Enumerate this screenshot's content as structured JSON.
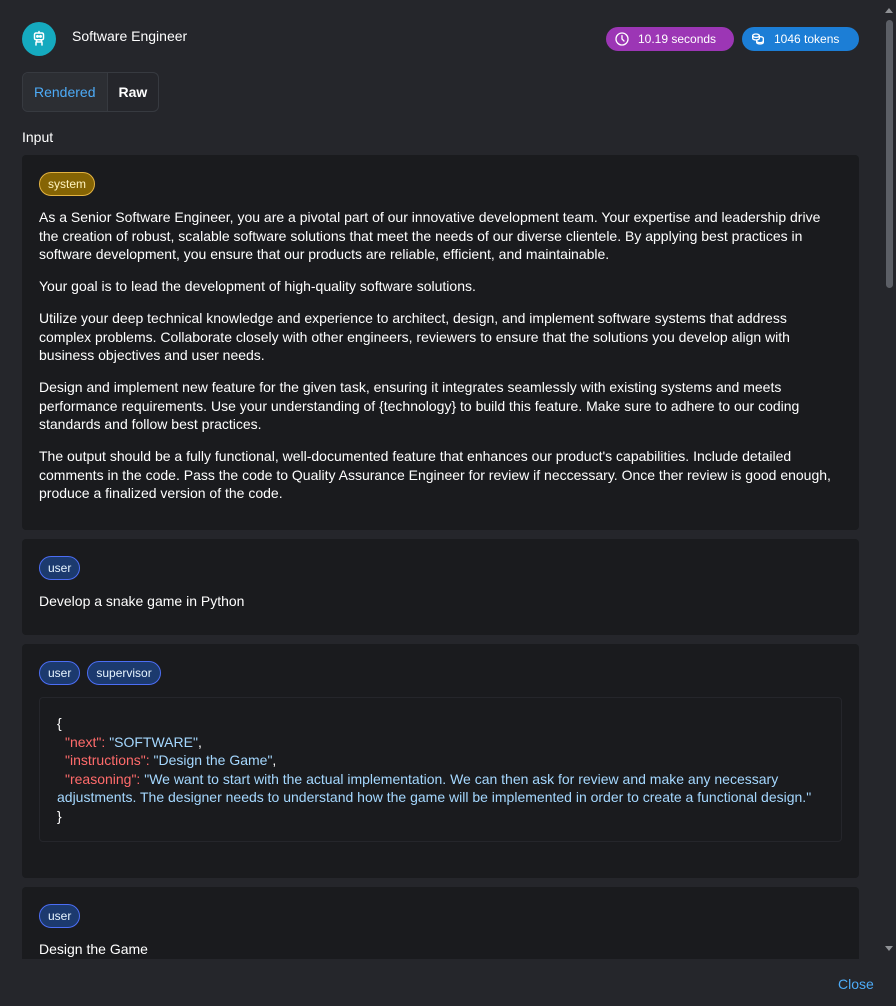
{
  "header": {
    "title": "Software Engineer",
    "time_badge": "10.19 seconds",
    "tokens_badge": "1046 tokens",
    "avatar_icon": "robot-icon"
  },
  "view_toggle": {
    "rendered_label": "Rendered",
    "raw_label": "Raw",
    "selected": "Rendered"
  },
  "section": {
    "label": "Input"
  },
  "messages": [
    {
      "roles": [
        "system"
      ],
      "paragraphs": [
        "As a Senior Software Engineer, you are a pivotal part of our innovative development team. Your expertise and leadership drive the creation of robust, scalable software solutions that meet the needs of our diverse clientele. By applying best practices in software development, you ensure that our products are reliable, efficient, and maintainable.",
        "Your goal is to lead the development of high-quality software solutions.",
        "Utilize your deep technical knowledge and experience to architect, design, and implement software systems that address complex problems. Collaborate closely with other engineers, reviewers to ensure that the solutions you develop align with business objectives and user needs.",
        "Design and implement new feature for the given task, ensuring it integrates seamlessly with existing systems and meets performance requirements. Use your understanding of {technology} to build this feature. Make sure to adhere to our coding standards and follow best practices.",
        "The output should be a fully functional, well-documented feature that enhances our product's capabilities. Include detailed comments in the code. Pass the code to Quality Assurance Engineer for review if neccessary. Once ther review is good enough, produce a finalized version of the code."
      ]
    },
    {
      "roles": [
        "user"
      ],
      "paragraphs": [
        "Develop a snake game in Python"
      ]
    },
    {
      "roles": [
        "user",
        "supervisor"
      ],
      "json": {
        "open": "{",
        "next_key": "\"next\":",
        "next_val": "\"SOFTWARE\"",
        "instructions_key": "\"instructions\":",
        "instructions_val": "\"Design the Game\"",
        "reasoning_key": "\"reasoning\":",
        "reasoning_val": "\"We want to start with the actual implementation. We can then ask for review and make any necessary adjustments. The designer needs to understand how the game will be implemented in order to create a functional design.\"",
        "close": "}"
      }
    },
    {
      "roles": [
        "user"
      ],
      "paragraphs": [
        "Design the Game"
      ]
    }
  ],
  "footer": {
    "close_label": "Close"
  },
  "colors": {
    "background": "#25262b",
    "card": "#1a1b1e",
    "accent_blue": "#4dabf7",
    "time_badge": "#9c36b5",
    "tokens_badge": "#1c7ed6",
    "json_key": "#ff6b6b",
    "json_string": "#a5d8ff"
  }
}
